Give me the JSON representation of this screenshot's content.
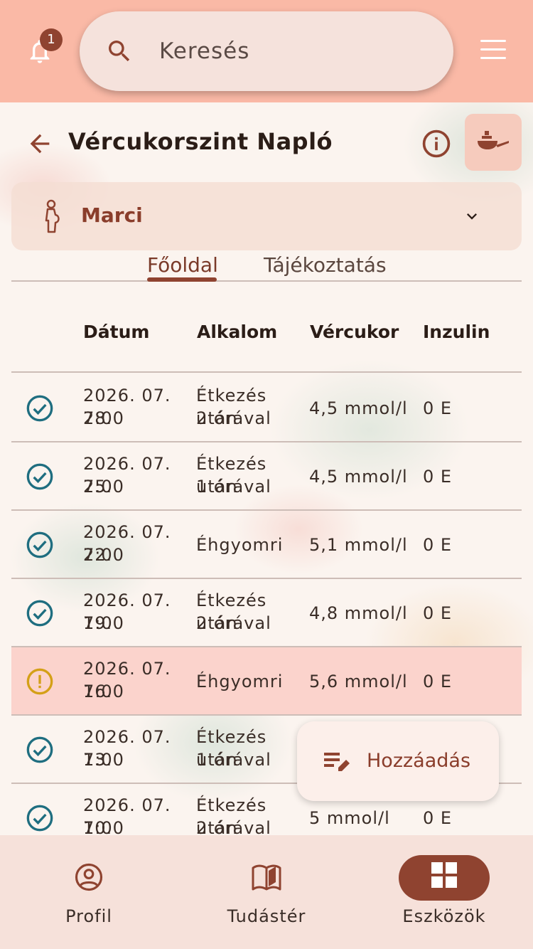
{
  "header": {
    "notification_count": "1",
    "search_placeholder": "Keresés"
  },
  "page": {
    "title": "Vércukorszint Napló"
  },
  "profile_selector": {
    "name": "Marci"
  },
  "tabs": [
    {
      "label": "Főoldal",
      "active": true
    },
    {
      "label": "Tájékoztatás",
      "active": false
    }
  ],
  "table": {
    "columns": [
      "Dátum",
      "Alkalom",
      "Vércukor",
      "Inzulin"
    ],
    "rows": [
      {
        "status": "ok",
        "date": "2026. 07. 28.",
        "time": "7:00",
        "occasion1": "Étkezés után",
        "occasion2": "2 órával",
        "blood_sugar": "4,5 mmol/l",
        "insulin": "0 E"
      },
      {
        "status": "ok",
        "date": "2026. 07. 25.",
        "time": "7:00",
        "occasion1": "Étkezés után",
        "occasion2": "1 órával",
        "blood_sugar": "4,5 mmol/l",
        "insulin": "0 E"
      },
      {
        "status": "ok",
        "date": "2026. 07. 22.",
        "time": "7:00",
        "occasion1": "Éhgyomri",
        "occasion2": "",
        "blood_sugar": "5,1 mmol/l",
        "insulin": "0 E"
      },
      {
        "status": "ok",
        "date": "2026. 07. 19.",
        "time": "7:00",
        "occasion1": "Étkezés után",
        "occasion2": "2 órával",
        "blood_sugar": "4,8 mmol/l",
        "insulin": "0 E"
      },
      {
        "status": "warning",
        "date": "2026. 07. 16.",
        "time": "7:00",
        "occasion1": "Éhgyomri",
        "occasion2": "",
        "blood_sugar": "5,6 mmol/l",
        "insulin": "0 E"
      },
      {
        "status": "ok",
        "date": "2026. 07. 13.",
        "time": "7:00",
        "occasion1": "Étkezés után",
        "occasion2": "1 órával",
        "blood_sugar": "",
        "insulin": ""
      },
      {
        "status": "ok",
        "date": "2026. 07. 10.",
        "time": "7:00",
        "occasion1": "Étkezés után",
        "occasion2": "2 órával",
        "blood_sugar": "5 mmol/l",
        "insulin": "0 E"
      }
    ]
  },
  "fab": {
    "label": "Hozzáadás"
  },
  "bottom_nav": [
    {
      "label": "Profil",
      "icon": "account-circle-icon",
      "active": false
    },
    {
      "label": "Tudástér",
      "icon": "book-icon",
      "active": false
    },
    {
      "label": "Eszközök",
      "icon": "grid-icon",
      "active": true
    }
  ],
  "colors": {
    "header_bg": "#fab9a6",
    "accent": "#8f4330",
    "ok_icon": "#1f6e80",
    "warn_icon": "#d4a017",
    "warn_row": "#fbd3cc"
  }
}
